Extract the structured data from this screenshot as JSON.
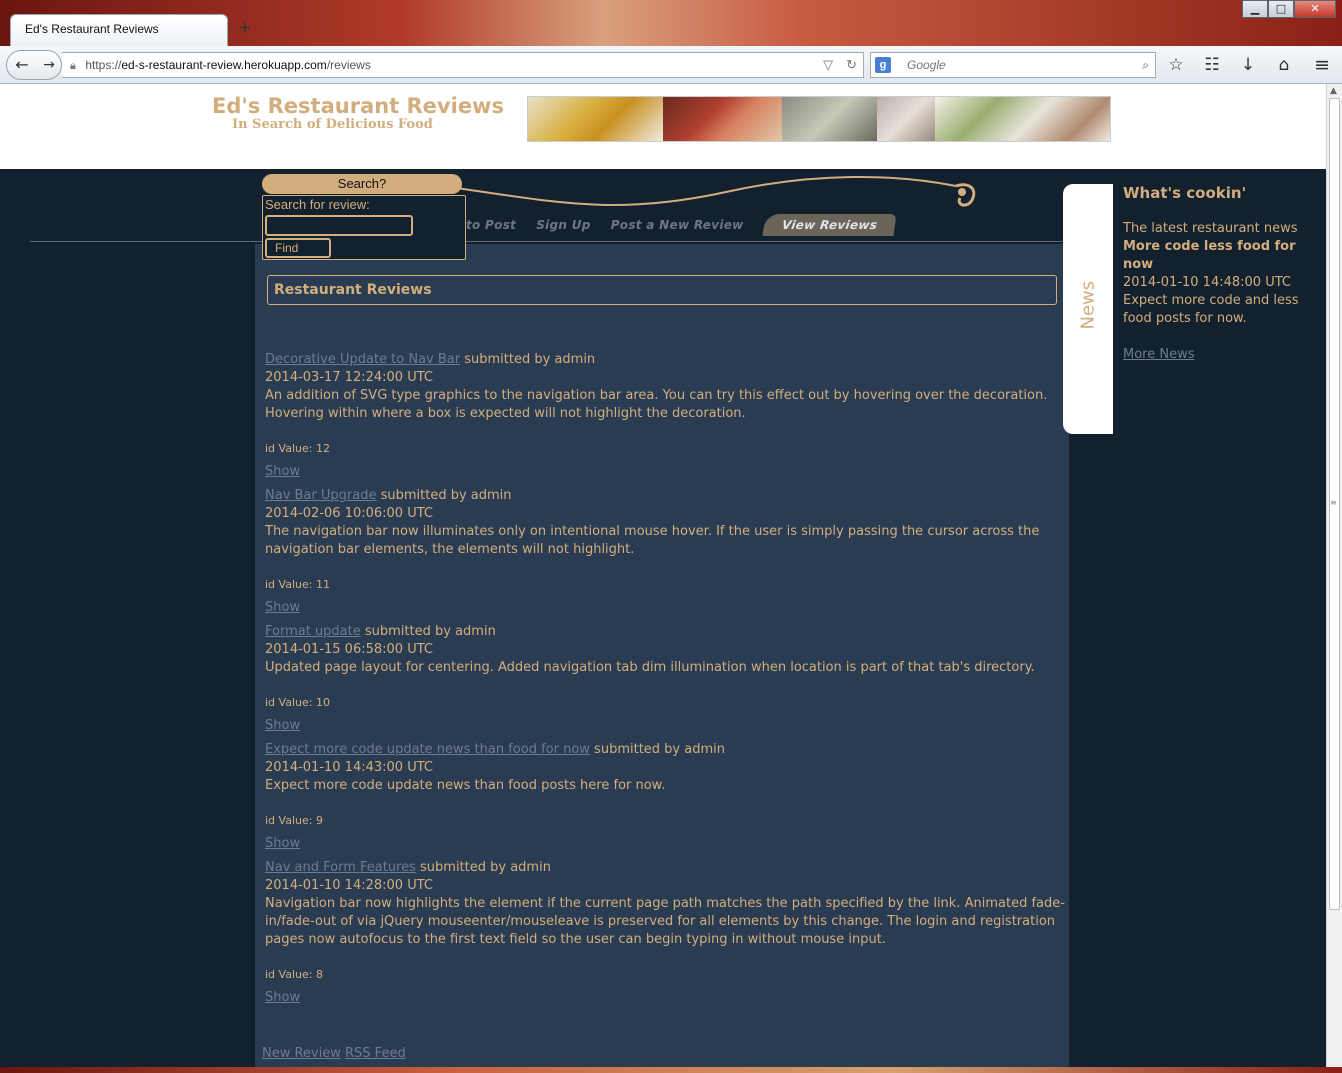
{
  "browser": {
    "tab_title": "Ed's Restaurant Reviews",
    "new_tab_symbol": "+",
    "url_protocol": "https://",
    "url_host": "ed-s-restaurant-review.herokuapp.com",
    "url_path": "/reviews",
    "search_placeholder": "Google",
    "window_buttons": [
      "▁",
      "□",
      "✕"
    ]
  },
  "site": {
    "title": "Ed's Restaurant Reviews",
    "subtitle": "In Search of Delicious Food"
  },
  "nav": {
    "items": [
      "to Post",
      "Sign Up",
      "Post a New Review",
      "View Reviews"
    ],
    "active": "View Reviews"
  },
  "search": {
    "pill_label": "Search?",
    "field_label": "Search for review:",
    "input_value": "",
    "button_label": "Find"
  },
  "main": {
    "heading": "Restaurant Reviews",
    "reviews": [
      {
        "title": "Decorative Update to Nav Bar",
        "byline": " submitted by admin",
        "date": "2014-03-17 12:24:00 UTC",
        "description": "An addition of SVG type graphics to the navigation bar area. You can try this effect out by hovering over the decoration. Hovering within where a box is expected will not highlight the decoration.",
        "id_label": "id Value: 12",
        "show_label": "Show"
      },
      {
        "title": "Nav Bar Upgrade",
        "byline": " submitted by admin",
        "date": "2014-02-06 10:06:00 UTC",
        "description": "The navigation bar now illuminates only on intentional mouse hover. If the user is simply passing the cursor across the navigation bar elements, the elements will not highlight.",
        "id_label": "id Value: 11",
        "show_label": "Show"
      },
      {
        "title": "Format update",
        "byline": " submitted by admin",
        "date": "2014-01-15 06:58:00 UTC",
        "description": "Updated page layout for centering. Added navigation tab dim illumination when location is part of that tab's directory.",
        "id_label": "id Value: 10",
        "show_label": "Show"
      },
      {
        "title": "Expect more code update news than food for now",
        "byline": " submitted by admin",
        "date": "2014-01-10 14:43:00 UTC",
        "description": "Expect more code update news than food posts here for now.",
        "id_label": "id Value: 9",
        "show_label": "Show"
      },
      {
        "title": "Nav and Form Features",
        "byline": " submitted by admin",
        "date": "2014-01-10 14:28:00 UTC",
        "description": "Navigation bar now highlights the element if the current page path matches the path specified by the link. Animated fade-in/fade-out of via jQuery mouseenter/mouseleave is preserved for all elements by this change. The login and registration pages now autofocus to the first text field so the user can begin typing in without mouse input.",
        "id_label": "id Value: 8",
        "show_label": "Show"
      }
    ],
    "footer_links": [
      "New Review",
      "RSS Feed"
    ]
  },
  "news": {
    "tab_label": "News",
    "heading": "What's cookin'",
    "intro": "The latest restaurant news",
    "headline": "More code less food for now",
    "date": "2014-01-10 14:48:00 UTC",
    "body": "Expect more code and less food posts for now.",
    "more_label": "More News"
  },
  "colors": {
    "accent": "#d2ae7e",
    "page_bg": "#13202e",
    "content_bg": "#2a3c52",
    "link": "#6e7c8b"
  },
  "icons": [
    "back-arrow-icon",
    "forward-arrow-icon",
    "lock-icon",
    "reload-icon",
    "google-icon",
    "search-magnifier-icon",
    "star-icon",
    "reading-list-icon",
    "download-icon",
    "home-icon",
    "menu-icon"
  ]
}
